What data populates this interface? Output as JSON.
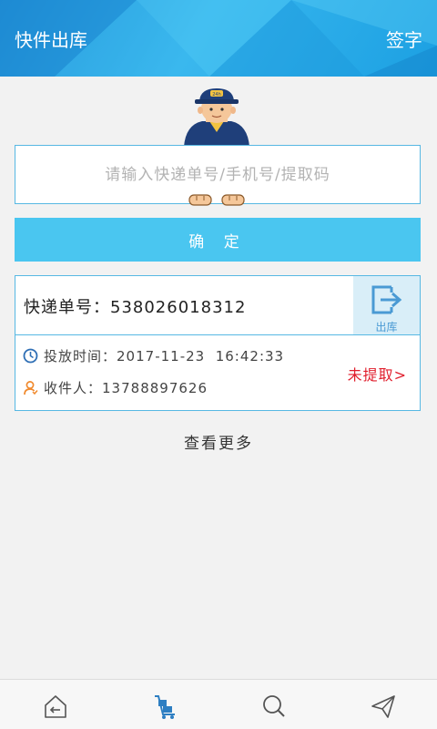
{
  "header": {
    "title": "快件出库",
    "sign_label": "签字"
  },
  "search": {
    "placeholder": "请输入快递单号/手机号/提取码",
    "value": ""
  },
  "confirm_label": "确 定",
  "parcel": {
    "tracking_label": "快递单号：",
    "tracking_number": "538026018312",
    "checkout_label": "出库",
    "time_label": "投放时间：",
    "time_value": "2017-11-23  16:42:33",
    "recipient_label": "收件人：",
    "recipient_value": "13788897626",
    "status": "未提取>"
  },
  "more_label": "查看更多",
  "mascot_cap_text": "24h",
  "colors": {
    "accent": "#4ac6f0",
    "border": "#57b8e3",
    "status": "#e01e2c",
    "header": "#2aa4e6"
  },
  "tabbar": {
    "items": [
      "home-return-icon",
      "delivery-cart-icon",
      "search-icon",
      "send-icon"
    ],
    "active": 1
  }
}
